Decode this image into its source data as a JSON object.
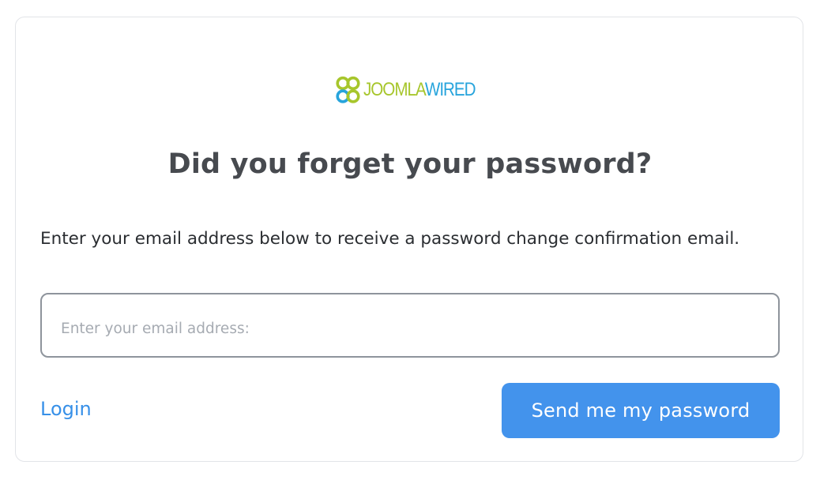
{
  "logo": {
    "part1": "JOOMLA",
    "part2": "WIRED",
    "icon": "joomlawired-clover-logo-icon",
    "colors": {
      "green": "#a7c62c",
      "blue": "#27a4dc"
    }
  },
  "form": {
    "title": "Did you forget your password?",
    "description": "Enter your email address below to receive a password change confirmation email.",
    "email_placeholder": "Enter your email address:",
    "email_value": "",
    "login_label": "Login",
    "submit_label": "Send me my password"
  },
  "colors": {
    "accent": "#4393ec",
    "link": "#3790e8",
    "title": "#474a4f",
    "text": "#2a2d31",
    "card_border": "#e2e4e8",
    "input_border": "#8e949c"
  }
}
